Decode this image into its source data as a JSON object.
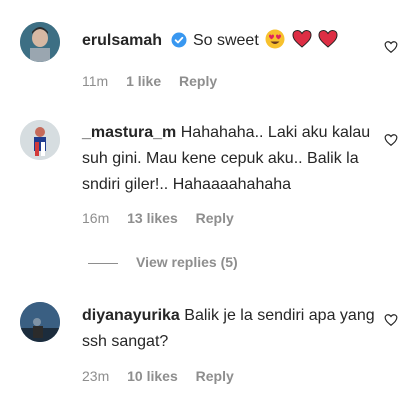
{
  "comments": [
    {
      "username": "erulsamah",
      "verified": true,
      "text": "So sweet",
      "emojis": [
        "heart-eyes-emoji",
        "red-heart-emoji",
        "red-heart-emoji"
      ],
      "time": "11m",
      "likes": "1 like",
      "reply": "Reply"
    },
    {
      "username": "_mastura_m",
      "text": "Hahahaha.. Laki aku kalau suh gini. Mau kene cepuk aku.. Balik la sndiri giler!.. Hahaaaahahaha",
      "time": "16m",
      "likes": "13 likes",
      "reply": "Reply"
    },
    {
      "username": "diyanayurika",
      "text": "Balik je la sendiri apa yang ssh sangat?",
      "time": "23m",
      "likes": "10 likes",
      "reply": "Reply"
    }
  ],
  "view_replies": "View replies (5)",
  "colors": {
    "text": "#262626",
    "secondary": "#8e8e8e",
    "verified": "#3897f0",
    "emoji_heart": "#e0245e"
  },
  "icons": {
    "like": "heart-outline-icon",
    "verified": "verified-badge-icon"
  }
}
